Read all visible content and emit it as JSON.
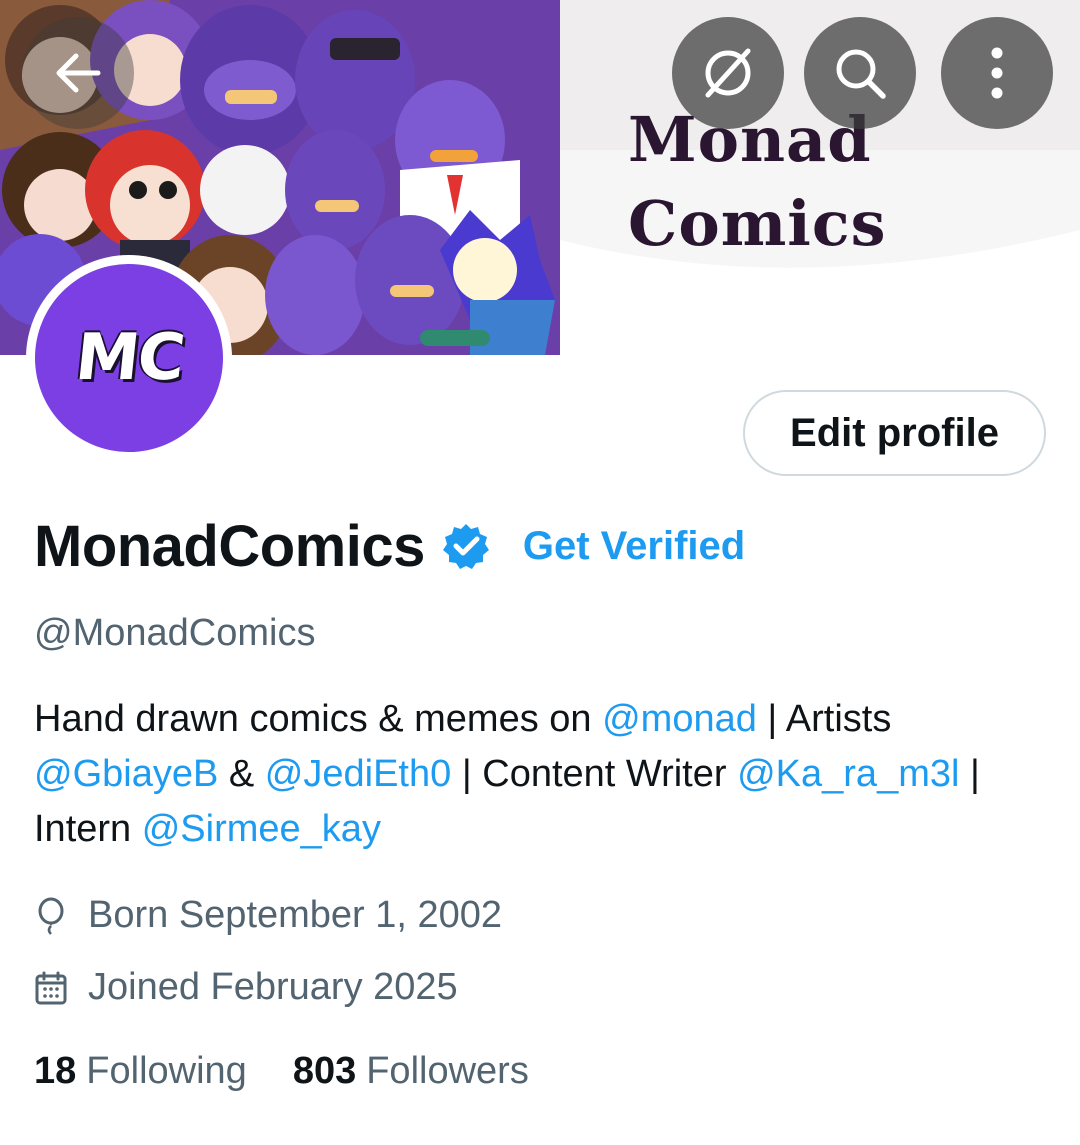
{
  "header": {
    "back_icon": "arrow-left-icon",
    "grok_icon": "grok-icon",
    "search_icon": "search-icon",
    "more_icon": "more-vertical-icon"
  },
  "banner": {
    "title_line1": "Monad",
    "title_line2": "Comics"
  },
  "avatar": {
    "initials": "MC",
    "color": "#7b3fe4"
  },
  "profile": {
    "edit_label": "Edit profile",
    "display_name": "MonadComics",
    "get_verified_label": "Get Verified",
    "handle": "@MonadComics",
    "bio": {
      "t1": "Hand drawn comics & memes on ",
      "m1": "@monad",
      "t2": " | Artists ",
      "m2": "@GbiayeB",
      "t3": " & ",
      "m3": "@JediEth0",
      "t4": " | Content Writer ",
      "m4": "@Ka_ra_m3l",
      "t5": " | Intern ",
      "m5": "@Sirmee_kay"
    },
    "born": "Born September 1, 2002",
    "joined": "Joined February 2025",
    "following_count": "18",
    "following_label": "Following",
    "followers_count": "803",
    "followers_label": "Followers"
  },
  "colors": {
    "accent": "#1d9bf0",
    "secondary_text": "#536471",
    "primary_text": "#0f1419",
    "border": "#cfd9de"
  }
}
